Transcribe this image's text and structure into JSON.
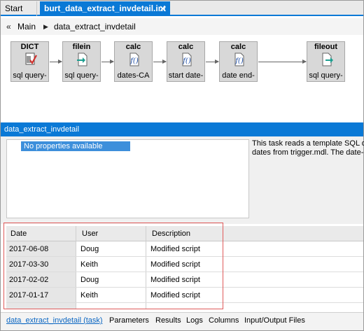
{
  "tabs": {
    "start_label": "Start",
    "active_label": "burt_data_extract_invdetail.int",
    "close_glyph": "✕"
  },
  "breadcrumb": {
    "back_glyph": "«",
    "main": "Main",
    "separator_glyph": "▶",
    "current": "data_extract_invdetail"
  },
  "flow": {
    "nodes": [
      {
        "title": "DICT",
        "subtitle": "sql query-",
        "icon": "dict-icon"
      },
      {
        "title": "filein",
        "subtitle": "sql query-",
        "icon": "file-in-icon"
      },
      {
        "title": "calc",
        "subtitle": "dates-CA",
        "icon": "function-icon"
      },
      {
        "title": "calc",
        "subtitle": "start date-",
        "icon": "function-icon"
      },
      {
        "title": "calc",
        "subtitle": "date end-",
        "icon": "function-icon"
      },
      {
        "title": "fileout",
        "subtitle": "sql query-",
        "icon": "file-out-icon"
      }
    ]
  },
  "properties": {
    "header": "data_extract_invdetail",
    "empty_label": "No properties available",
    "description_lines": [
      "This task reads a template SQL q",
      "dates from trigger.mdl. The date-p"
    ]
  },
  "history": {
    "columns": [
      "Date",
      "User",
      "Description"
    ],
    "rows": [
      {
        "date": "2017-06-08",
        "user": "Doug",
        "description": "Modified script"
      },
      {
        "date": "2017-03-30",
        "user": "Keith",
        "description": "Modified script"
      },
      {
        "date": "2017-02-02",
        "user": "Doug",
        "description": "Modified script"
      },
      {
        "date": "2017-01-17",
        "user": "Keith",
        "description": "Modified script"
      }
    ]
  },
  "bottom_tabs": [
    "data_extract_invdetail (task)",
    "Parameters",
    "Results",
    "Logs",
    "Columns",
    "Input/Output Files"
  ],
  "colors": {
    "accent": "#0a79d6",
    "highlight_outline": "#e05a5a"
  }
}
